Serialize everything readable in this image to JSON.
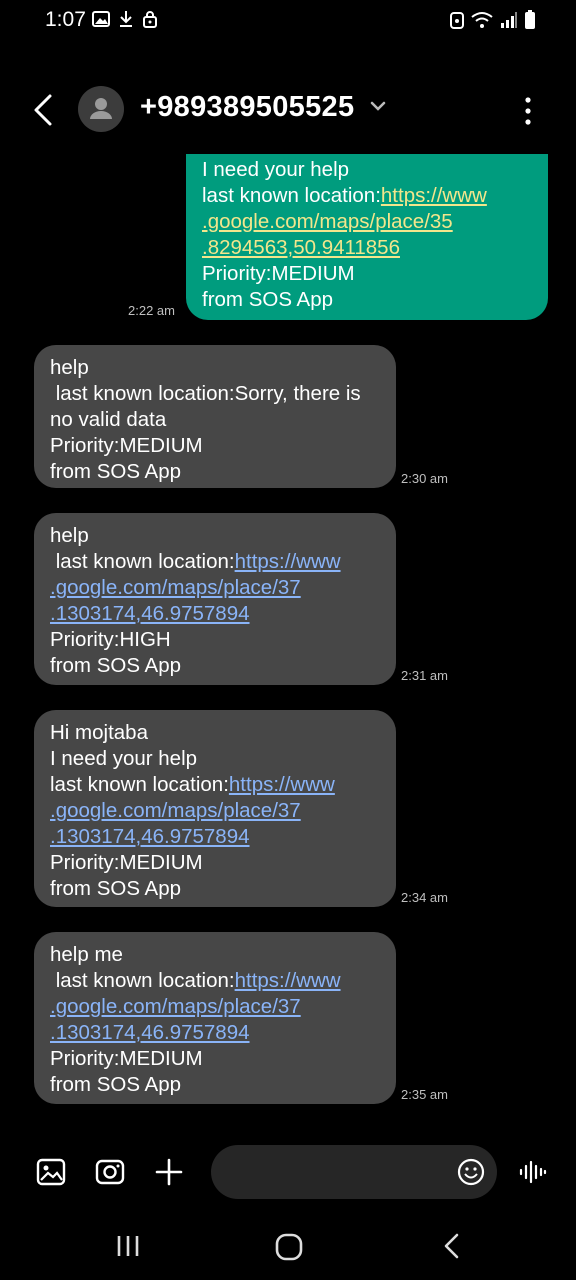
{
  "status_bar": {
    "time": "1:07",
    "left_icons": [
      "image-icon",
      "download-icon",
      "lock-icon"
    ],
    "right_icons": [
      "alarm-icon",
      "wifi-icon",
      "signal-icon",
      "battery-icon"
    ]
  },
  "header": {
    "contact": "+989389505525",
    "back_icon": "back-arrow-icon",
    "avatar_icon": "person-icon",
    "menu_icon": "more-vertical-icon"
  },
  "messages": [
    {
      "direction": "sent",
      "lines": [
        {
          "text": "I need your help",
          "link": false
        },
        {
          "pre": "last known location:",
          "text": "https://www",
          "link": true
        },
        {
          "text": ".google.com/maps/place/35",
          "link": true
        },
        {
          "text": ".8294563,50.9411856",
          "link": true
        },
        {
          "text": "Priority:MEDIUM",
          "link": false
        },
        {
          "text": "from SOS App",
          "link": false
        }
      ],
      "time": "2:22 am"
    },
    {
      "direction": "received",
      "lines": [
        {
          "text": "help",
          "link": false
        },
        {
          "text": " last known location:Sorry, there is",
          "link": false
        },
        {
          "text": "no valid data",
          "link": false
        },
        {
          "text": "Priority:MEDIUM",
          "link": false
        },
        {
          "text": "from SOS App",
          "link": false
        }
      ],
      "time": "2:30 am"
    },
    {
      "direction": "received",
      "lines": [
        {
          "text": "help",
          "link": false
        },
        {
          "pre": " last known location:",
          "text": "https://www",
          "link": true
        },
        {
          "text": ".google.com/maps/place/37",
          "link": true
        },
        {
          "text": ".1303174,46.9757894",
          "link": true
        },
        {
          "text": "Priority:HIGH",
          "link": false
        },
        {
          "text": "from SOS App",
          "link": false
        }
      ],
      "time": "2:31 am"
    },
    {
      "direction": "received",
      "lines": [
        {
          "text": "Hi mojtaba",
          "link": false
        },
        {
          "text": "I need your help",
          "link": false
        },
        {
          "pre": "last known location:",
          "text": "https://www",
          "link": true
        },
        {
          "text": ".google.com/maps/place/37",
          "link": true
        },
        {
          "text": ".1303174,46.9757894",
          "link": true
        },
        {
          "text": "Priority:MEDIUM",
          "link": false
        },
        {
          "text": "from SOS App",
          "link": false
        }
      ],
      "time": "2:34 am"
    },
    {
      "direction": "received",
      "lines": [
        {
          "text": "help me",
          "link": false
        },
        {
          "pre": " last known location:",
          "text": "https://www",
          "link": true
        },
        {
          "text": ".google.com/maps/place/37",
          "link": true
        },
        {
          "text": ".1303174,46.9757894",
          "link": true
        },
        {
          "text": "Priority:MEDIUM",
          "link": false
        },
        {
          "text": "from SOS App",
          "link": false
        }
      ],
      "time": "2:35 am"
    }
  ],
  "composer": {
    "buttons": [
      "gallery-icon",
      "camera-icon",
      "add-icon"
    ],
    "input_value": "",
    "emoji_icon": "emoji-icon",
    "voice_icon": "voice-record-icon"
  },
  "nav_bar": {
    "buttons": [
      "recent-apps-icon",
      "home-icon",
      "back-icon"
    ]
  },
  "colors": {
    "sent_bubble": "#009c7e",
    "received_bubble": "#474747",
    "sent_link": "#f2e68c",
    "received_link": "#8ab4f8"
  }
}
